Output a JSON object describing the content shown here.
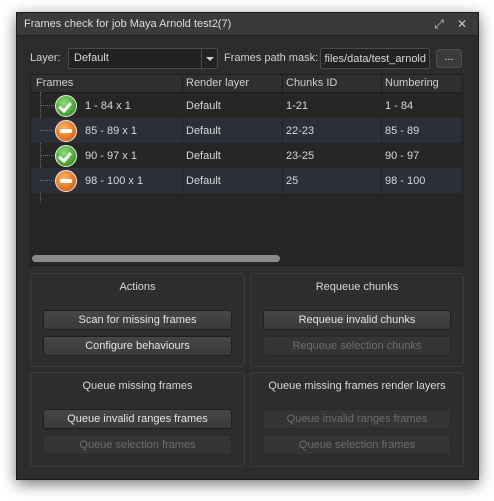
{
  "window": {
    "title": "Frames check for job Maya Arnold test2(7)"
  },
  "controls": {
    "layer_label": "Layer:",
    "layer_value": "Default",
    "mask_label": "Frames path mask:",
    "mask_value": "t_files/data/test_arnold",
    "browse_label": "..."
  },
  "table": {
    "headers": [
      "Frames",
      "Render layer",
      "Chunks ID",
      "Numbering"
    ],
    "rows": [
      {
        "status": "ok",
        "frames": "1 - 84 x 1",
        "layer": "Default",
        "chunks": "1-21",
        "numbering": "1 - 84"
      },
      {
        "status": "invalid",
        "frames": "85 - 89 x 1",
        "layer": "Default",
        "chunks": "22-23",
        "numbering": "85 - 89"
      },
      {
        "status": "ok",
        "frames": "90 - 97 x 1",
        "layer": "Default",
        "chunks": "23-25",
        "numbering": "90 - 97"
      },
      {
        "status": "invalid",
        "frames": "98 - 100 x 1",
        "layer": "Default",
        "chunks": "25",
        "numbering": "98 - 100"
      }
    ]
  },
  "groups": {
    "actions": {
      "title": "Actions",
      "btn1": "Scan for missing frames",
      "btn2": "Configure behaviours"
    },
    "requeue": {
      "title": "Requeue chunks",
      "btn1": "Requeue invalid chunks",
      "btn2": "Requeue selection chunks"
    },
    "queue_missing": {
      "title": "Queue missing frames",
      "btn1": "Queue invalid ranges frames",
      "btn2": "Queue selection frames"
    },
    "queue_layers": {
      "title": "Queue missing frames render layers",
      "btn1": "Queue invalid ranges frames",
      "btn2": "Queue selection frames"
    }
  },
  "colors": {
    "ok": "#4caf35",
    "invalid": "#f07a1c",
    "accent_row": "#2b3038"
  },
  "icons": {
    "ok": "check-circle-icon",
    "invalid": "minus-circle-icon",
    "maximize": "maximize-icon",
    "close": "close-icon"
  }
}
